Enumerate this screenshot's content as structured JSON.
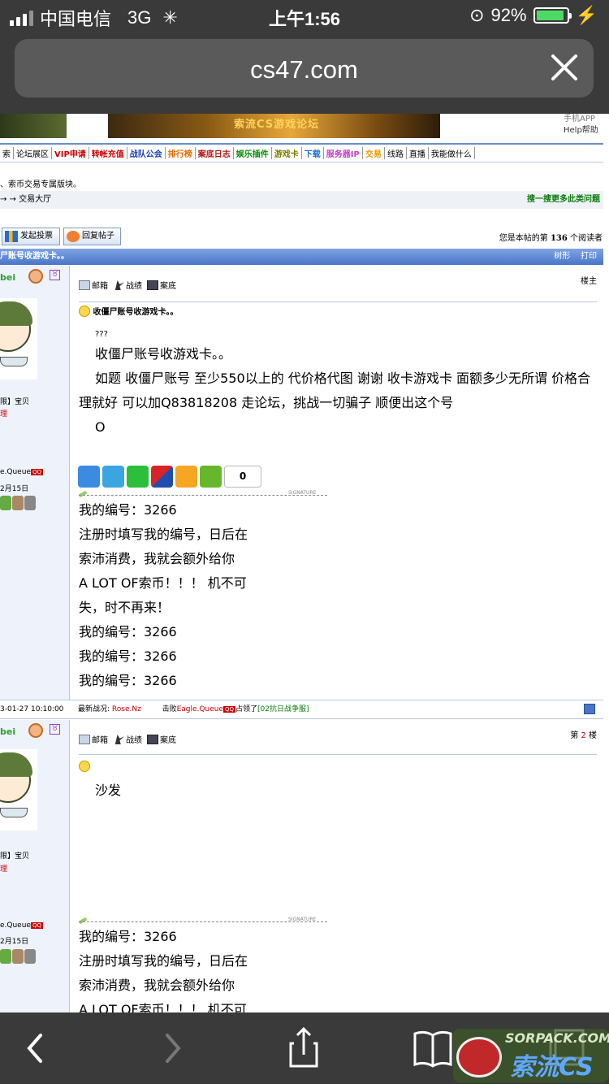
{
  "status_bar": {
    "carrier": "中国电信",
    "network": "3G",
    "time": "上午1:56",
    "battery": "92%"
  },
  "browser": {
    "url": "cs47.com"
  },
  "banner": {
    "text": "索流CS游戏论坛",
    "right_line1": "手机APP",
    "right_line2": "Help帮助"
  },
  "nav": {
    "items": [
      {
        "label": "索",
        "color": "#000000"
      },
      {
        "label": "论坛展区",
        "color": "#000000"
      },
      {
        "label": "VIP申请",
        "color": "#cc0000"
      },
      {
        "label": "转帐充值",
        "color": "#cc0000"
      },
      {
        "label": "战队公会",
        "color": "#1a3fb0"
      },
      {
        "label": "排行榜",
        "color": "#e36b00"
      },
      {
        "label": "案底日志",
        "color": "#b01a1a"
      },
      {
        "label": "娱乐插件",
        "color": "#0a8a0a"
      },
      {
        "label": "游戏卡",
        "color": "#7a7a00"
      },
      {
        "label": "下载",
        "color": "#1a6fd0"
      },
      {
        "label": "服务器IP",
        "color": "#c040c0"
      },
      {
        "label": "交易",
        "color": "#e89a00"
      },
      {
        "label": "线路",
        "color": "#000000"
      },
      {
        "label": "直播",
        "color": "#000000"
      },
      {
        "label": "我能做什么",
        "color": "#000000"
      }
    ]
  },
  "notice": "、索币交易专属版块。",
  "breadcrumb": {
    "path": "→ → 交易大厅",
    "search_more": "搜一搜更多此类问题"
  },
  "actions": {
    "vote": "发起投票",
    "reply": "回复帖子",
    "readers_prefix": "您是本帖的第",
    "readers_count": "136",
    "readers_suffix": "个阅读者"
  },
  "thread": {
    "title": "尸账号收游戏卡。。",
    "tree_view": "树形",
    "print": "打印"
  },
  "posts": [
    {
      "username": "bei",
      "rank": "限】宝贝",
      "role": "理",
      "team": "e.Queue",
      "date": "2月15日",
      "tools": {
        "mail": "邮箱",
        "stats": "战绩",
        "record": "案底"
      },
      "floor_label": "楼主",
      "subject": "收僵尸账号收游戏卡。。",
      "content": {
        "marks": "???",
        "line1": "收僵尸账号收游戏卡。。",
        "line2": "如题 收僵尸账号 至少550以上的 代价格代图 谢谢 收卡游戏卡 面额多少无所谓 价格合理就好 可以加Q83818208 走论坛，挑战一切骗子 顺便出这个号",
        "line3": "O"
      },
      "share_count": "0",
      "signature_label": "SIGNATURE",
      "signature": [
        "我的编号：3266",
        "注册时填写我的编号，日后在",
        "索沛消费，我就会额外给你",
        "A LOT OF索币！！！ 机不可",
        "失，时不再来！",
        "我的编号：3266",
        "我的编号：3266",
        "我的编号：3266"
      ],
      "footer": {
        "date": "3-01-27 10:10:00",
        "latest": "最新战况:",
        "winner": "Rose.Nz",
        "defeat": "击败",
        "loser": "Eagle.Queue",
        "occupied": "占领了",
        "server": "[02抗日战争服]"
      }
    },
    {
      "username": "bei",
      "rank": "限】宝贝",
      "role": "理",
      "team": "e.Queue",
      "date": "2月15日",
      "tools": {
        "mail": "邮箱",
        "stats": "战绩",
        "record": "案底"
      },
      "floor_prefix": "第",
      "floor_num": "2",
      "floor_suffix": "楼",
      "content": {
        "line1": "沙发"
      },
      "signature_label": "SIGNATURE",
      "signature": [
        "我的编号：3266",
        "注册时填写我的编号，日后在",
        "索沛消费，我就会额外给你",
        "A LOT OF索币！！！ 机不可"
      ]
    }
  ],
  "watermark": {
    "line1": "SORPACK.COM",
    "line2": "索流CS"
  }
}
